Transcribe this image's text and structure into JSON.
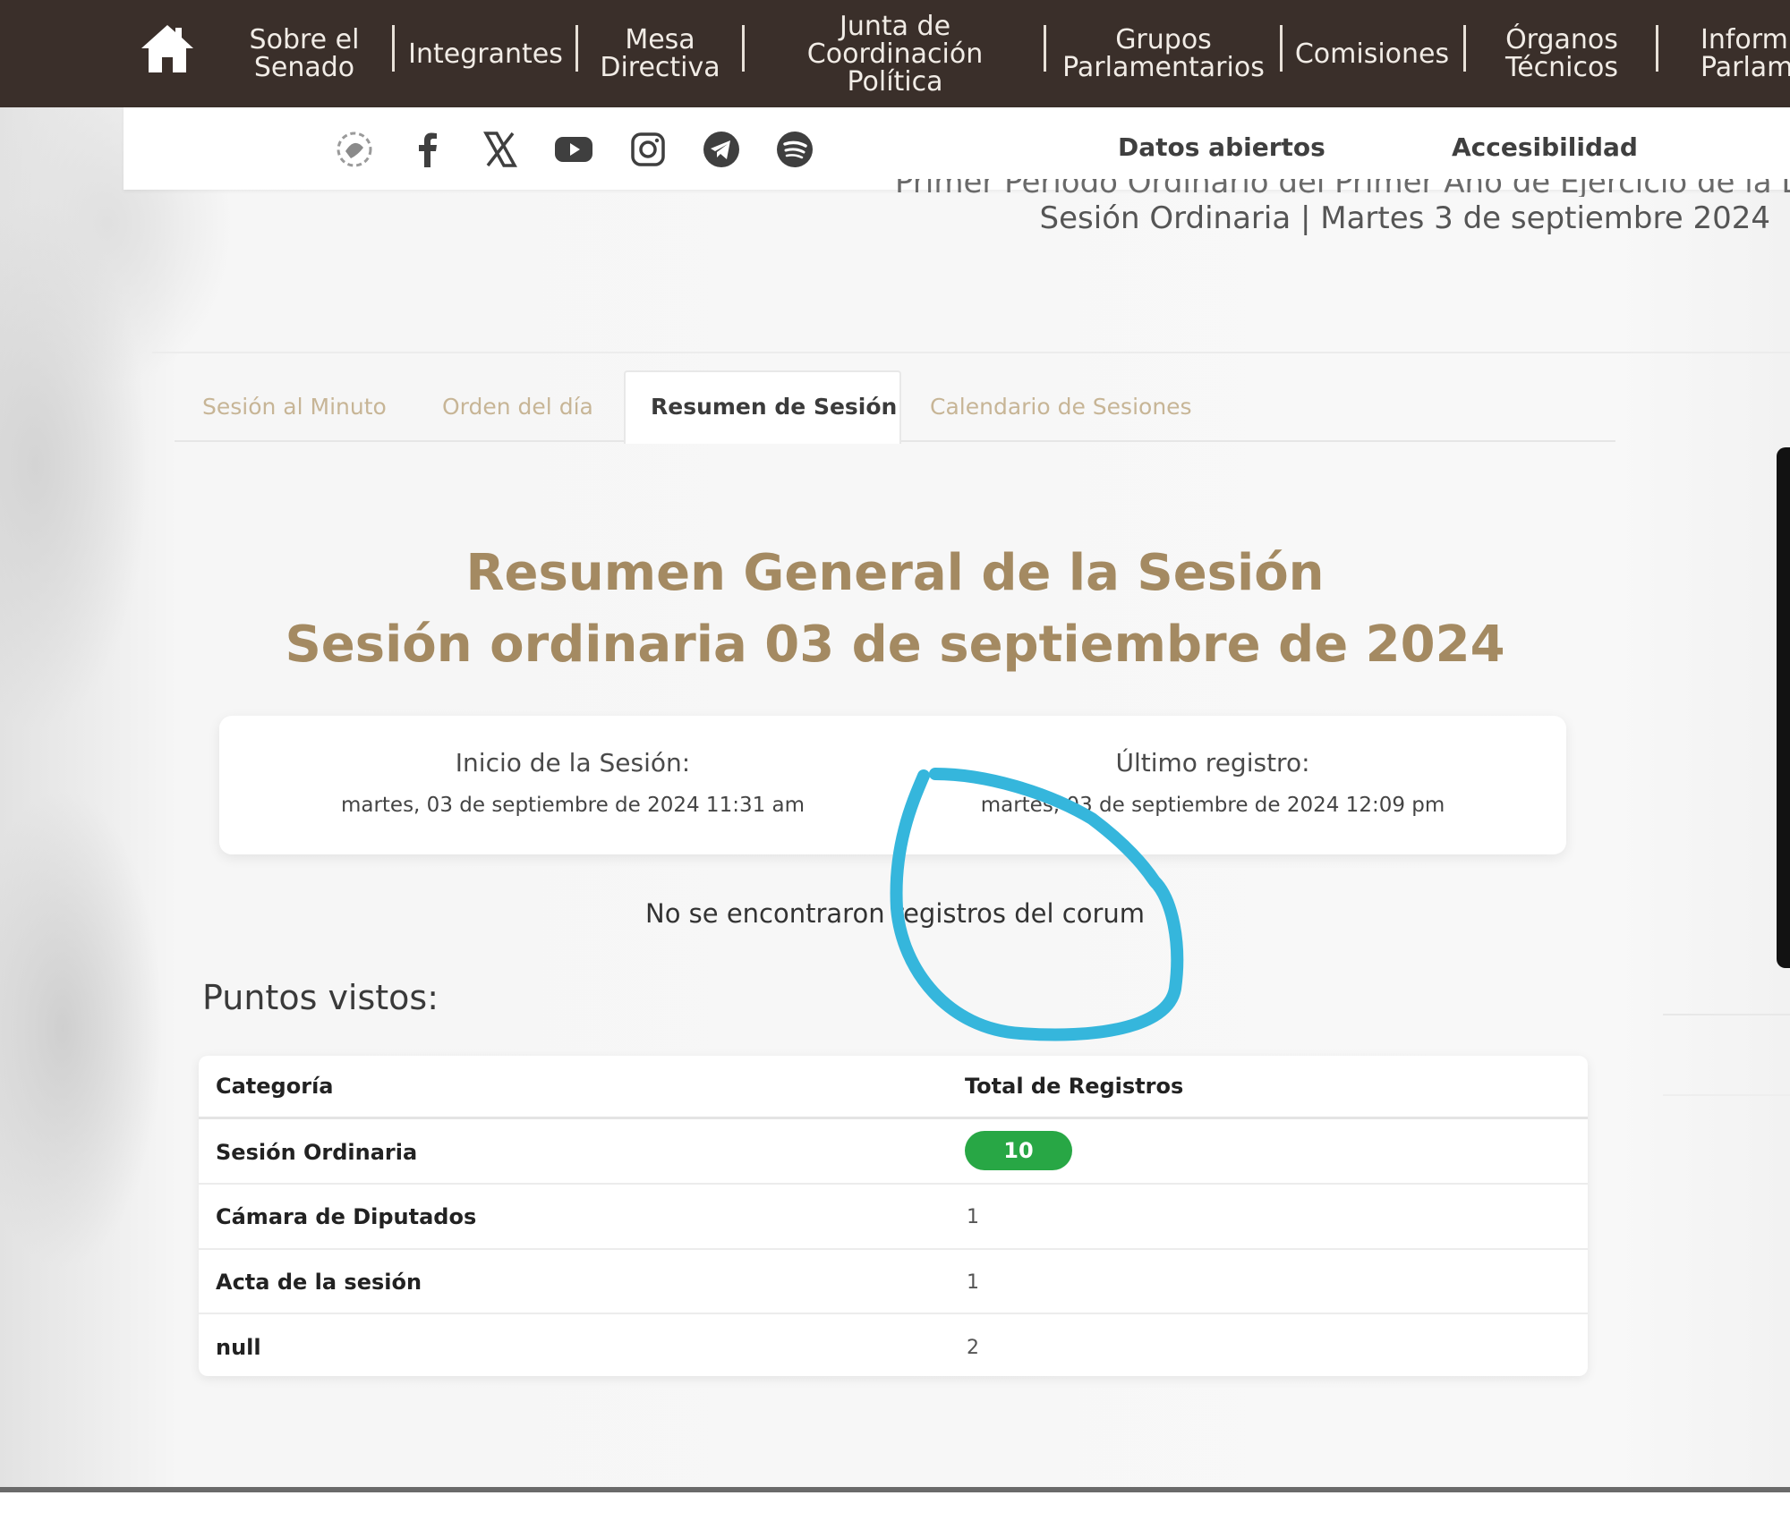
{
  "nav": {
    "items": [
      {
        "label": "Sobre el\nSenado"
      },
      {
        "label": "Integrantes"
      },
      {
        "label": "Mesa\nDirectiva"
      },
      {
        "label": "Junta de\nCoordinación\nPolítica"
      },
      {
        "label": "Grupos\nParlamentarios"
      },
      {
        "label": "Comisiones"
      },
      {
        "label": "Órganos\nTécnicos"
      },
      {
        "label": "Inform\nParlam"
      }
    ]
  },
  "social": {
    "icons": [
      "senado-logo-icon",
      "facebook-icon",
      "x-twitter-icon",
      "youtube-icon",
      "instagram-icon",
      "telegram-icon",
      "spotify-icon"
    ]
  },
  "subnav": {
    "datos_abiertos": "Datos abiertos",
    "accesibilidad": "Accesibilidad"
  },
  "header": {
    "period_line": "Primer Periodo Ordinario del Primer Año de Ejercicio de la LXVI",
    "session_line": "Sesión Ordinaria | Martes 3 de septiembre 2024"
  },
  "tabs": [
    {
      "label": "Sesión al Minuto",
      "active": false
    },
    {
      "label": "Orden del día",
      "active": false
    },
    {
      "label": "Resumen de Sesión",
      "active": true
    },
    {
      "label": "Calendario de Sesiones",
      "active": false
    }
  ],
  "summary": {
    "title_line1": "Resumen General de la Sesión",
    "title_line2": "Sesión ordinaria 03 de septiembre de 2024",
    "inicio_label": "Inicio de la Sesión:",
    "inicio_value": "martes, 03 de septiembre de 2024 11:31 am",
    "ultimo_label": "Último registro:",
    "ultimo_value": "martes, 03 de septiembre de 2024 12:09 pm",
    "no_records": "No se encontraron registros del corum"
  },
  "puntos": {
    "heading": "Puntos vistos:",
    "columns": [
      "Categoría",
      "Total de Registros"
    ],
    "rows": [
      {
        "categoria": "Sesión Ordinaria",
        "total": "10",
        "badge": true
      },
      {
        "categoria": "Cámara de Diputados",
        "total": "1"
      },
      {
        "categoria": "Acta de la sesión",
        "total": "1"
      },
      {
        "categoria": "null",
        "total": "2"
      }
    ]
  },
  "colors": {
    "nav_bg": "#3a2f2a",
    "title_gold": "#a48a62",
    "tab_inactive": "#c7b596",
    "badge_green": "#28a745",
    "annotation_blue": "#35b6dc"
  }
}
